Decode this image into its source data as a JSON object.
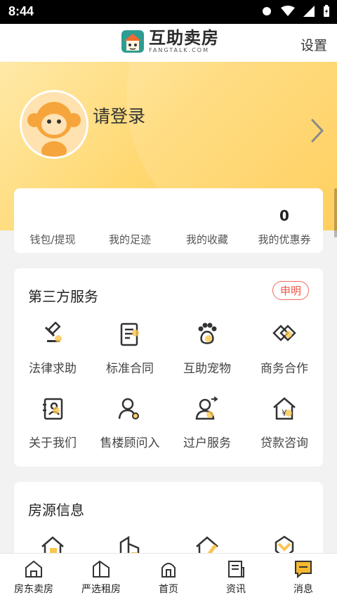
{
  "status_bar": {
    "time": "8:44"
  },
  "header": {
    "brand_name": "互助卖房",
    "brand_sub": "FANGTALK.COM",
    "settings_label": "设置"
  },
  "profile": {
    "login_prompt": "请登录"
  },
  "stats": [
    {
      "value": "",
      "label": "钱包/提现"
    },
    {
      "value": "",
      "label": "我的足迹"
    },
    {
      "value": "",
      "label": "我的收藏"
    },
    {
      "value": "0",
      "label": "我的优惠券"
    }
  ],
  "services": {
    "title": "第三方服务",
    "badge": "申明",
    "items": [
      {
        "label": "法律求助",
        "icon": "gavel-icon"
      },
      {
        "label": "标准合同",
        "icon": "contract-icon"
      },
      {
        "label": "互助宠物",
        "icon": "paw-icon"
      },
      {
        "label": "商务合作",
        "icon": "handshake-icon"
      },
      {
        "label": "关于我们",
        "icon": "id-card-icon"
      },
      {
        "label": "售楼顾问入",
        "icon": "consultant-icon"
      },
      {
        "label": "过户服务",
        "icon": "transfer-person-icon"
      },
      {
        "label": "贷款咨询",
        "icon": "loan-house-icon"
      }
    ]
  },
  "houses": {
    "title": "房源信息"
  },
  "tabs": [
    {
      "label": "房东卖房",
      "icon": "house-icon"
    },
    {
      "label": "严选租房",
      "icon": "building-icon"
    },
    {
      "label": "首页",
      "icon": "home-door-icon"
    },
    {
      "label": "资讯",
      "icon": "news-icon"
    },
    {
      "label": "消息",
      "icon": "message-icon"
    }
  ],
  "colors": {
    "accent": "#ffc94a",
    "badge_red": "#f05545",
    "active_tab": "#f5b82e"
  }
}
